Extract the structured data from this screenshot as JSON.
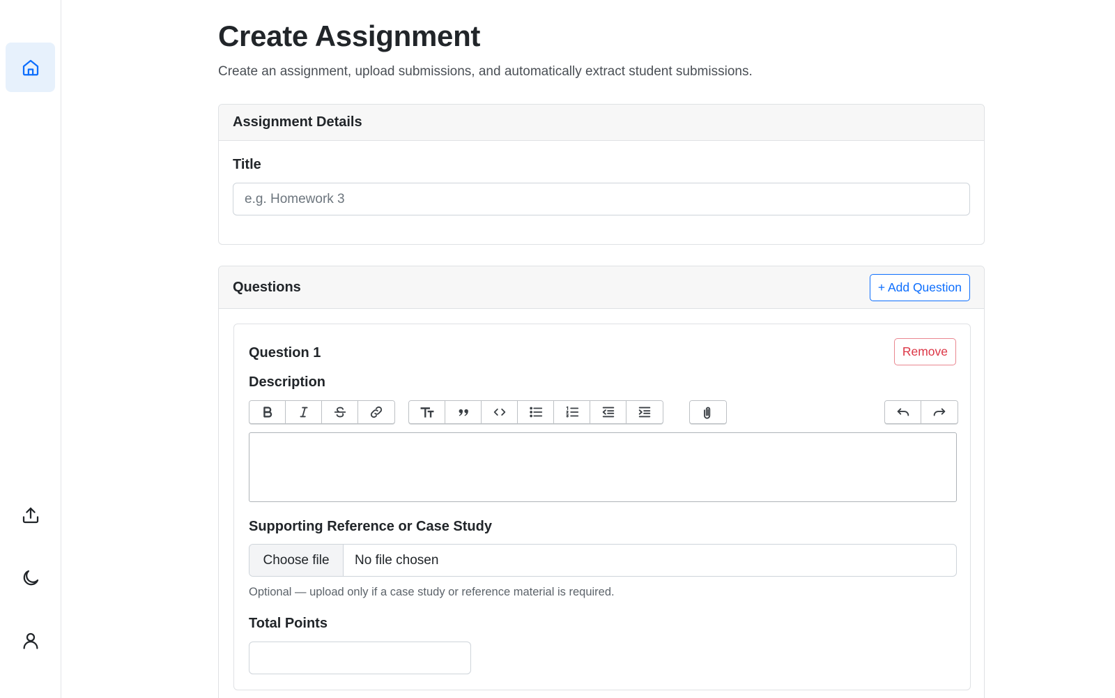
{
  "sidebar": {
    "items": [
      {
        "name": "home",
        "icon": "home-icon",
        "active": true
      },
      {
        "name": "upload",
        "icon": "upload-icon",
        "active": false
      },
      {
        "name": "theme",
        "icon": "moon-icon",
        "active": false
      },
      {
        "name": "profile",
        "icon": "user-icon",
        "active": false
      }
    ],
    "accent_color": "#0d6efd",
    "active_bg": "#e7f1fc"
  },
  "header": {
    "title": "Create Assignment",
    "subtitle": "Create an assignment, upload submissions, and automatically extract student submissions."
  },
  "details": {
    "section_title": "Assignment Details",
    "title_label": "Title",
    "title_value": "",
    "title_placeholder": "e.g. Homework 3"
  },
  "questions": {
    "section_title": "Questions",
    "add_label": "+ Add Question",
    "items": [
      {
        "title": "Question 1",
        "remove_label": "Remove",
        "description_label": "Description",
        "description_value": "",
        "toolbar": {
          "groups": [
            [
              "bold-icon",
              "italic-icon",
              "strikethrough-icon",
              "link-icon"
            ],
            [
              "heading-icon",
              "quote-icon",
              "code-icon",
              "bullet-list-icon",
              "numbered-list-icon",
              "outdent-icon",
              "indent-icon"
            ],
            [
              "attach-icon"
            ],
            [
              "undo-icon",
              "redo-icon"
            ]
          ]
        },
        "reference_label": "Supporting Reference or Case Study",
        "file_button_label": "Choose file",
        "file_status": "No file chosen",
        "reference_help": "Optional — upload only if a case study or reference material is required.",
        "points_label": "Total Points",
        "points_value": ""
      }
    ]
  },
  "colors": {
    "primary": "#0d6efd",
    "danger": "#dc3545",
    "danger_border": "#e9868f",
    "text": "#212529",
    "muted": "#6c757d"
  }
}
